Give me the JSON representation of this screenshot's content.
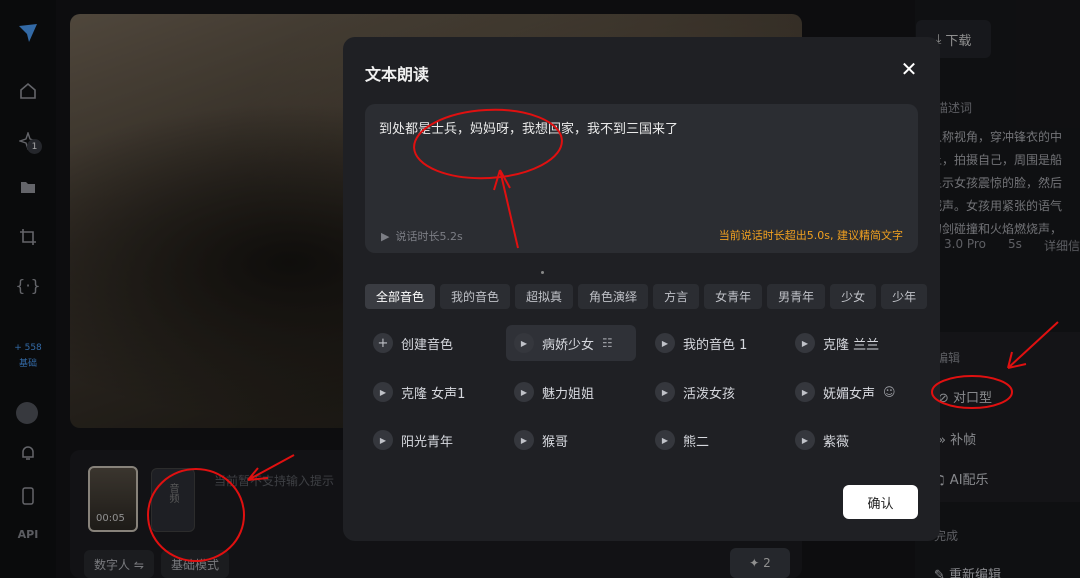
{
  "sidebar": {
    "badge": "1",
    "credits": "+ 558",
    "credits_label": "基础",
    "api": "API"
  },
  "background": {
    "video_time": "00:05",
    "audio_thumb_label": "音频",
    "hint": "当前暂不支持输入提示",
    "mode_pill_1": "数字人 ⇋",
    "mode_pill_2": "基础模式",
    "generate_count": "✦ 2"
  },
  "right_panel": {
    "download": "下载",
    "section_desc": "描述词",
    "desc_lines": [
      "人称视角，穿冲锋衣的中",
      "上，拍摄自己，周围是船",
      "显示女孩震惊的脸，然后",
      "喊声。女孩用紧张的语气",
      "刀剑碰撞和火焰燃烧声，"
    ],
    "meta_model": "3.0 Pro",
    "meta_duration": "5s",
    "meta_detail": "详细信",
    "section_edit": "编辑",
    "lip_sync": "对口型",
    "frame_fill": "补帧",
    "ai_dub": "AI配乐",
    "section_done": "完成",
    "re_edit": "重新编辑"
  },
  "modal": {
    "title": "文本朗读",
    "text": "到处都是士兵，妈妈呀，我想回家，我不到三国来了",
    "duration": "说话时长5.2s",
    "warning": "当前说话时长超出5.0s, 建议精简文字",
    "tabs": [
      "全部音色",
      "我的音色",
      "超拟真",
      "角色演绎",
      "方言",
      "女青年",
      "男青年",
      "少女",
      "少年"
    ],
    "voices": [
      {
        "label": "创建音色",
        "trail": ""
      },
      {
        "label": "病娇少女",
        "trail": "☷"
      },
      {
        "label": "我的音色 1",
        "trail": ""
      },
      {
        "label": "克隆 兰兰",
        "trail": ""
      },
      {
        "label": "克隆 女声1",
        "trail": ""
      },
      {
        "label": "魅力姐姐",
        "trail": ""
      },
      {
        "label": "活泼女孩",
        "trail": ""
      },
      {
        "label": "妩媚女声",
        "trail": "☺"
      },
      {
        "label": "阳光青年",
        "trail": ""
      },
      {
        "label": "猴哥",
        "trail": ""
      },
      {
        "label": "熊二",
        "trail": ""
      },
      {
        "label": "紫薇",
        "trail": ""
      }
    ],
    "confirm": "确认"
  },
  "colors": {
    "warning": "#f0a020",
    "annotation": "#e01010",
    "accent": "#4fa3ff"
  }
}
